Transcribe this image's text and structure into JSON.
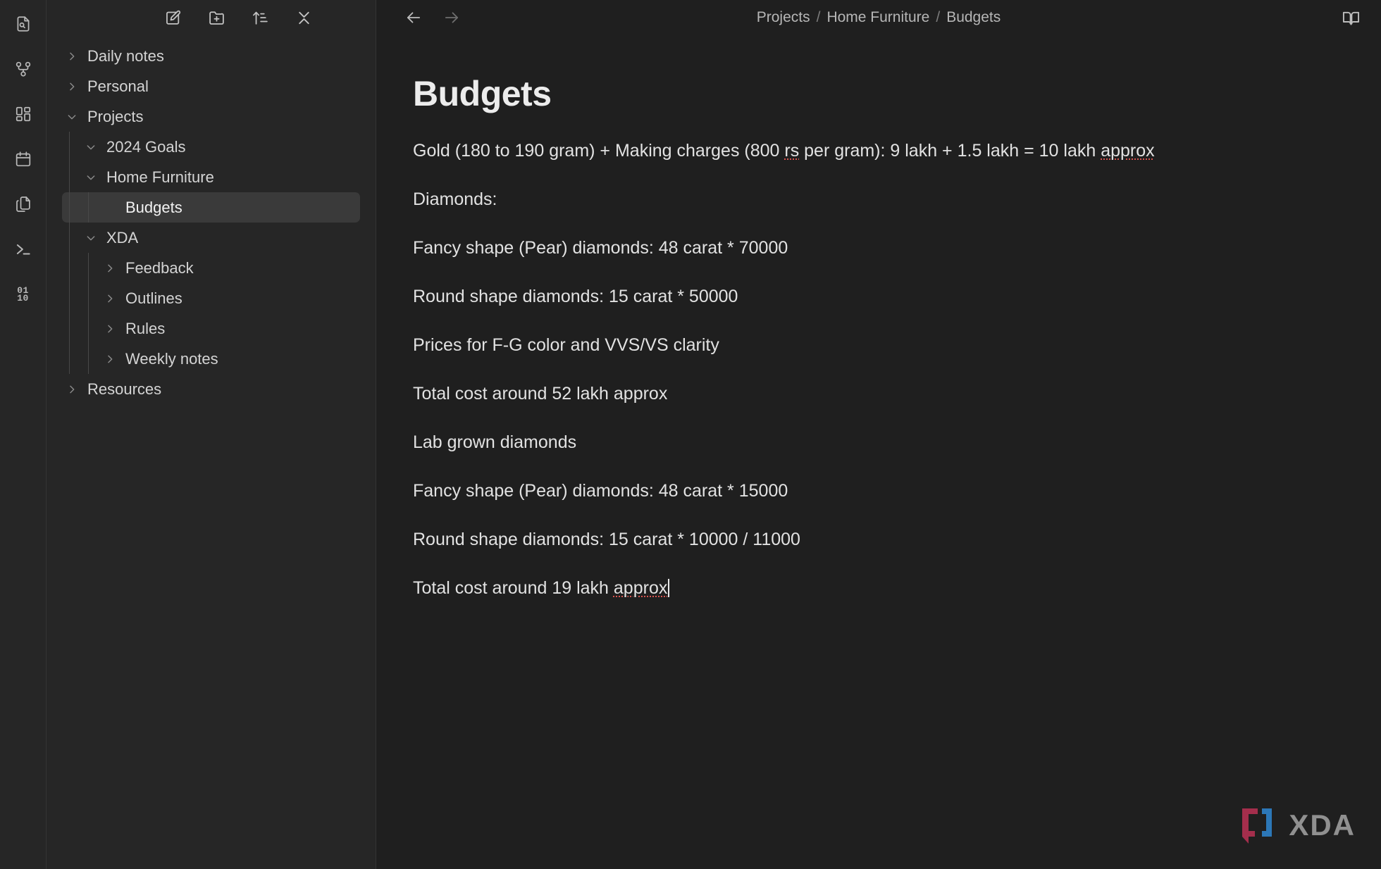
{
  "activity_bar": {
    "items": [
      {
        "name": "search-file-icon",
        "title": "Search"
      },
      {
        "name": "graph-view-icon",
        "title": "Graph view"
      },
      {
        "name": "dashboard-icon",
        "title": "Dashboard"
      },
      {
        "name": "calendar-icon",
        "title": "Calendar"
      },
      {
        "name": "files-copy-icon",
        "title": "Files"
      },
      {
        "name": "terminal-icon",
        "title": "Terminal"
      },
      {
        "name": "binary-icon",
        "title": "Binary",
        "glyph_top": "01",
        "glyph_bottom": "10"
      }
    ]
  },
  "sidebar": {
    "toolbar": [
      {
        "name": "new-note-button",
        "title": "New note"
      },
      {
        "name": "new-folder-button",
        "title": "New folder"
      },
      {
        "name": "sort-button",
        "title": "Change sort order"
      },
      {
        "name": "collapse-all-button",
        "title": "Collapse all"
      }
    ],
    "tree": [
      {
        "label": "Daily notes",
        "depth": 0,
        "twisty": "right",
        "selected": false
      },
      {
        "label": "Personal",
        "depth": 0,
        "twisty": "right",
        "selected": false
      },
      {
        "label": "Projects",
        "depth": 0,
        "twisty": "down",
        "selected": false
      },
      {
        "label": "2024 Goals",
        "depth": 1,
        "twisty": "down",
        "selected": false
      },
      {
        "label": "Home Furniture",
        "depth": 1,
        "twisty": "down",
        "selected": false
      },
      {
        "label": "Budgets",
        "depth": 2,
        "twisty": "none",
        "selected": true
      },
      {
        "label": "XDA",
        "depth": 1,
        "twisty": "down",
        "selected": false
      },
      {
        "label": "Feedback",
        "depth": 2,
        "twisty": "right",
        "selected": false
      },
      {
        "label": "Outlines",
        "depth": 2,
        "twisty": "right",
        "selected": false
      },
      {
        "label": "Rules",
        "depth": 2,
        "twisty": "right",
        "selected": false
      },
      {
        "label": "Weekly notes",
        "depth": 2,
        "twisty": "right",
        "selected": false
      },
      {
        "label": "Resources",
        "depth": 0,
        "twisty": "right",
        "selected": false
      }
    ]
  },
  "topbar": {
    "back_label": "Back",
    "forward_label": "Forward",
    "breadcrumb": [
      "Projects",
      "Home Furniture",
      "Budgets"
    ],
    "breadcrumb_separator": "/",
    "reading_mode_label": "Reading view"
  },
  "document": {
    "title": "Budgets",
    "paragraphs": [
      {
        "id": "p1",
        "segments": [
          {
            "text": "Gold (180 to 190 gram) + Making charges (800 ",
            "spell": false
          },
          {
            "text": "rs",
            "spell": true
          },
          {
            "text": " per gram): 9 lakh + 1.5 lakh = 10 lakh ",
            "spell": false
          },
          {
            "text": "approx",
            "spell": true
          }
        ]
      },
      {
        "id": "p2",
        "segments": [
          {
            "text": "Diamonds:",
            "spell": false
          }
        ]
      },
      {
        "id": "p3",
        "segments": [
          {
            "text": "Fancy shape (Pear) diamonds: 48 carat * 70000",
            "spell": false
          }
        ]
      },
      {
        "id": "p4",
        "segments": [
          {
            "text": "Round shape diamonds: 15 carat * 50000",
            "spell": false
          }
        ]
      },
      {
        "id": "p5",
        "segments": [
          {
            "text": "Prices for F-G color and VVS/VS clarity",
            "spell": false
          }
        ]
      },
      {
        "id": "p6",
        "segments": [
          {
            "text": "Total cost around 52 lakh approx",
            "spell": false
          }
        ]
      },
      {
        "id": "p7",
        "segments": [
          {
            "text": "Lab grown diamonds",
            "spell": false
          }
        ]
      },
      {
        "id": "p8",
        "segments": [
          {
            "text": "Fancy shape (Pear) diamonds: 48 carat * 15000",
            "spell": false
          }
        ]
      },
      {
        "id": "p9",
        "segments": [
          {
            "text": "Round shape diamonds: 15 carat * 10000 / 11000",
            "spell": false
          }
        ]
      },
      {
        "id": "p10",
        "caret": true,
        "segments": [
          {
            "text": "Total cost around 19 lakh ",
            "spell": false
          },
          {
            "text": "approx",
            "spell": true
          }
        ]
      }
    ]
  },
  "watermark": {
    "text": "XDA",
    "mark_left_color": "#b03050",
    "mark_right_color": "#2e7fc4",
    "text_color": "#9a9a9a"
  },
  "colors": {
    "app_bg": "#212121",
    "sidebar_bg": "#262626",
    "content_bg": "#1f1f1f",
    "selected_row": "#3a3a3a",
    "text_primary": "#e2e2e2",
    "text_muted": "#b6b6b6",
    "spellcheck": "#d9534f"
  }
}
